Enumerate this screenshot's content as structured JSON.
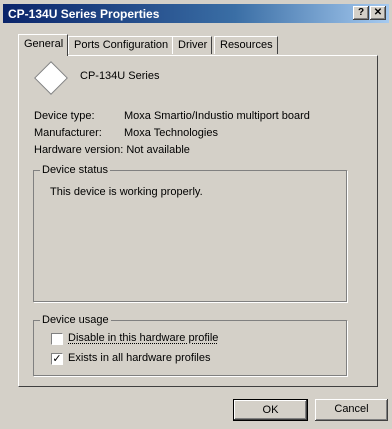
{
  "window": {
    "title": "CP-134U Series Properties",
    "help_label": "?",
    "close_label": "✕"
  },
  "tabs": [
    {
      "label": "General",
      "active": true
    },
    {
      "label": "Ports Configuration"
    },
    {
      "label": "Driver"
    },
    {
      "label": "Resources"
    }
  ],
  "device": {
    "icon": "diamond-device-icon",
    "name": "CP-134U Series",
    "type_label": "Device type:",
    "type_value": "Moxa Smartio/Industio multiport board",
    "manufacturer_label": "Manufacturer:",
    "manufacturer_value": "Moxa Technologies",
    "hardware_version_text": "Hardware version: Not available"
  },
  "status": {
    "group_label": "Device status",
    "text": "This device is working properly."
  },
  "usage": {
    "group_label": "Device usage",
    "disable_label": "Disable in this hardware profile",
    "disable_checked": false,
    "exists_label": "Exists in all hardware profiles",
    "exists_checked": true,
    "check_mark": "✓"
  },
  "buttons": {
    "ok": "OK",
    "cancel": "Cancel"
  }
}
